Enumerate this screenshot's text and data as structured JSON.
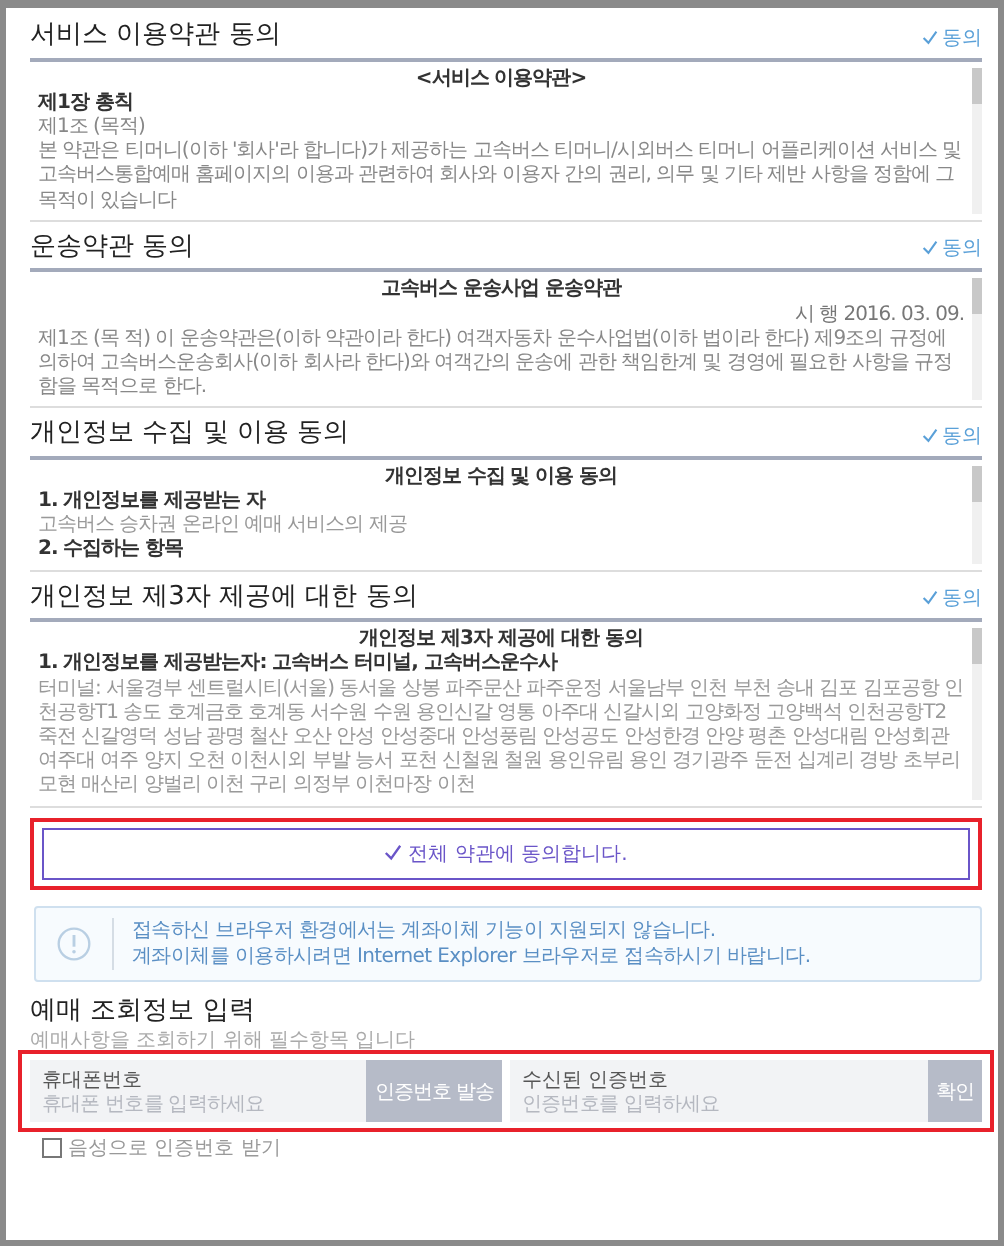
{
  "sections": [
    {
      "title": "서비스 이용약관 동의",
      "agree": "동의",
      "content": [
        {
          "kind": "heading",
          "text": "<서비스 이용약관>"
        },
        {
          "kind": "bold",
          "text": "제1장 총칙"
        },
        {
          "kind": "text",
          "text": "제1조 (목적)"
        },
        {
          "kind": "text",
          "text": "본 약관은 티머니(이하 '회사'라 합니다)가 제공하는 고속버스 티머니/시외버스 티머니 어플리케이션 서비스 및 고속버스통합예매 홈페이지의 이용과 관련하여 회사와 이용자 간의 권리, 의무 및 기타 제반 사항을 정함에 그 목적이 있습니다"
        }
      ]
    },
    {
      "title": "운송약관 동의",
      "agree": "동의",
      "content": [
        {
          "kind": "heading",
          "text": "고속버스 운송사업 운송약관"
        },
        {
          "kind": "date",
          "text": "시 행 2016. 03. 09."
        },
        {
          "kind": "text",
          "text": "제1조 (목 적) 이 운송약관은(이하 약관이라 한다) 여객자동차 운수사업법(이하 법이라 한다) 제9조의 규정에 의하여 고속버스운송회사(이하 회사라 한다)와 여객간의 운송에 관한 책임한계 및 경영에 필요한 사항을 규정함을 목적으로 한다."
        }
      ]
    },
    {
      "title": "개인정보 수집 및 이용 동의",
      "agree": "동의",
      "content": [
        {
          "kind": "heading",
          "text": "개인정보 수집 및 이용 동의"
        },
        {
          "kind": "bold",
          "text": "1. 개인정보를 제공받는 자"
        },
        {
          "kind": "muted",
          "text": "고속버스 승차권 온라인 예매 서비스의 제공"
        },
        {
          "kind": "bold",
          "text": "2. 수집하는 항목"
        }
      ]
    },
    {
      "title": "개인정보 제3자 제공에 대한 동의",
      "agree": "동의",
      "content": [
        {
          "kind": "heading",
          "text": "개인정보 제3자 제공에 대한 동의"
        },
        {
          "kind": "bold",
          "text": "1. 개인정보를 제공받는자: 고속버스 터미널, 고속버스운수사"
        },
        {
          "kind": "muted",
          "text": "터미널: 서울경부 센트럴시티(서울) 동서울 상봉 파주문산 파주운정 서울남부 인천 부천 송내 김포 김포공항 인천공항T1 송도 호계금호 호계동 서수원 수원 용인신갈 영통 아주대 신갈시외 고양화정 고양백석 인천공항T2 죽전 신갈영덕 성남 광명 철산 오산 안성 안성중대 안성풍림 안성공도 안성한경 안양 평촌 안성대림 안성회관 여주대 여주 양지 오천 이천시외 부발 능서 포천 신철원 철원 용인유림 용인 경기광주 둔전 십계리 경방 초부리 모현 매산리 양벌리 이천 구리 의정부 이천마장 이천"
        }
      ]
    }
  ],
  "agree_all": {
    "label": "전체 약관에 동의합니다.",
    "highlighted": true
  },
  "notice": [
    "접속하신 브라우저 환경에서는 계좌이체 기능이 지원되지 않습니다.",
    "계좌이체를 이용하시려면 Internet Explorer 브라우저로 접속하시기 바랍니다."
  ],
  "lookup": {
    "title": "예매 조회정보 입력",
    "subtitle": "예매사항을 조회하기 위해 필수항목 입니다",
    "highlighted": true,
    "fields": [
      {
        "label": "휴대폰번호",
        "placeholder": "휴대폰 번호를 입력하세요",
        "button": "인증번호 발송"
      },
      {
        "label": "수신된 인증번호",
        "placeholder": "인증번호를 입력하세요",
        "button": "확인"
      }
    ],
    "checkbox": {
      "label": "음성으로 인증번호 받기",
      "checked": false
    }
  }
}
